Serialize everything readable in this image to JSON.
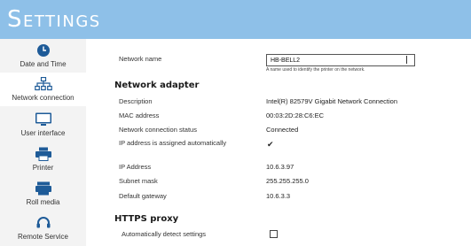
{
  "header": {
    "title": "Settings"
  },
  "sidebar": {
    "items": [
      {
        "label": "Date and Time",
        "icon": "clock-icon",
        "active": false
      },
      {
        "label": "Network connection",
        "icon": "network-icon",
        "active": true
      },
      {
        "label": "User interface",
        "icon": "monitor-icon",
        "active": false
      },
      {
        "label": "Printer",
        "icon": "printer-icon",
        "active": false
      },
      {
        "label": "Roll media",
        "icon": "roll-media-icon",
        "active": false
      },
      {
        "label": "Remote Service",
        "icon": "headset-icon",
        "active": false
      }
    ]
  },
  "network_name": {
    "label": "Network name",
    "value": "HB-BELL2",
    "hint": "A name used to identify the printer on the network."
  },
  "network_adapter": {
    "heading": "Network adapter",
    "description": {
      "label": "Description",
      "value": "Intel(R) 82579V Gigabit Network Connection"
    },
    "mac": {
      "label": "MAC address",
      "value": "00:03:2D:28:C6:EC"
    },
    "status": {
      "label": "Network connection status",
      "value": "Connected"
    },
    "auto_ip": {
      "label": "IP address is assigned automatically",
      "checked": true,
      "mark": "✔"
    },
    "ip": {
      "label": "IP Address",
      "value": "10.6.3.97"
    },
    "subnet": {
      "label": "Subnet mask",
      "value": "255.255.255.0"
    },
    "gateway": {
      "label": "Default gateway",
      "value": "10.6.3.3"
    }
  },
  "https_proxy": {
    "heading": "HTTPS proxy",
    "auto_detect": {
      "label": "Automatically detect settings",
      "checked": false
    }
  },
  "colors": {
    "header": "#8ec0e8",
    "icon": "#1e5b98",
    "sidebar": "#f3f3f3"
  }
}
